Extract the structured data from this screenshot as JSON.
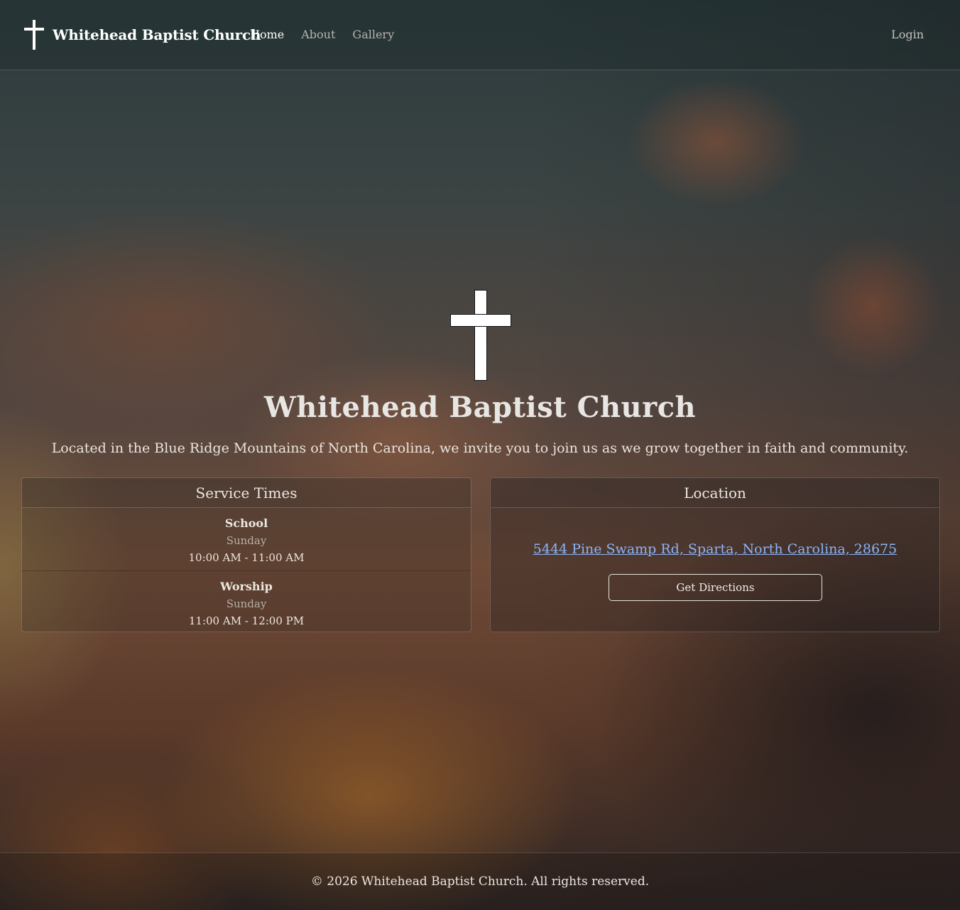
{
  "navbar": {
    "brand_icon": "cross-icon",
    "brand_title": "Whitehead Baptist Church",
    "links": [
      {
        "label": "Home",
        "active": true
      },
      {
        "label": "About",
        "active": false
      },
      {
        "label": "Gallery",
        "active": false
      }
    ],
    "login_label": "Login"
  },
  "hero": {
    "icon": "cross-icon",
    "title": "Whitehead Baptist Church",
    "subtitle": "Located in the Blue Ridge Mountains of North Carolina, we invite you to join us as we grow together in faith and community."
  },
  "services": {
    "title": "Service Times",
    "items": [
      {
        "name": "School",
        "day": "Sunday",
        "time": "10:00 AM - 11:00 AM"
      },
      {
        "name": "Worship",
        "day": "Sunday",
        "time": "11:00 AM - 12:00 PM"
      }
    ]
  },
  "location": {
    "title": "Location",
    "address": "5444 Pine Swamp Rd, Sparta, North Carolina, 28675",
    "directions_label": "Get Directions"
  },
  "footer": {
    "text": "© 2026 Whitehead Baptist Church. All rights reserved."
  },
  "colors": {
    "link": "#8ab4f8",
    "text": "#e9e4df",
    "white": "#ffffff"
  }
}
